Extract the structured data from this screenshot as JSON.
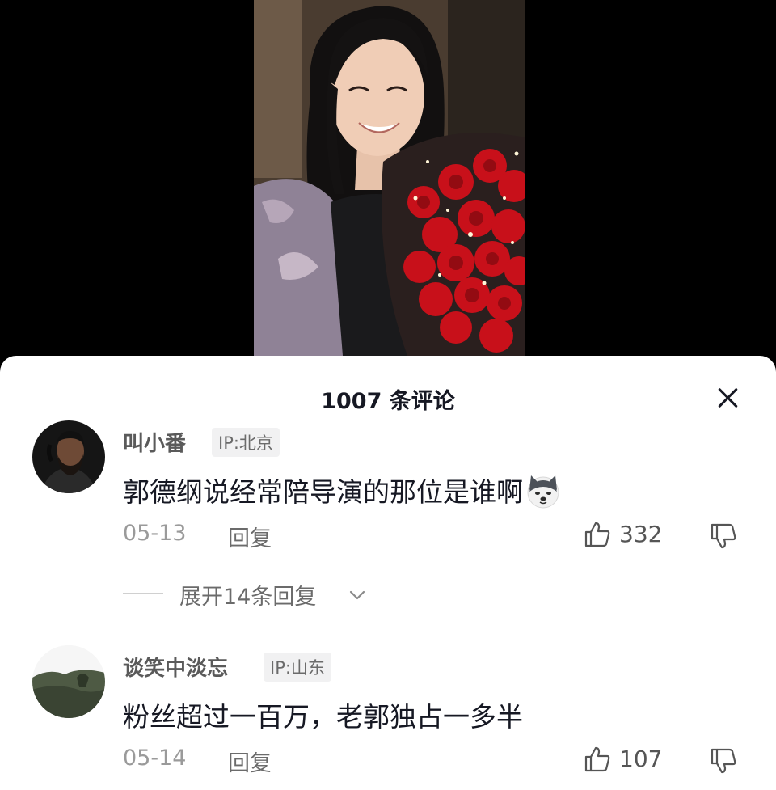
{
  "sheet": {
    "title": "1007 条评论",
    "close_icon": "close-icon"
  },
  "comments": [
    {
      "username": "叫小番",
      "ip": "IP:北京",
      "text": "郭德纲说经常陪导演的那位是谁啊",
      "emoji": "husky-dog-emoji",
      "date": "05-13",
      "reply": "回复",
      "likes": "332",
      "expand": "展开14条回复"
    },
    {
      "username": "谈笑中淡忘",
      "ip": "IP:山东",
      "text": "粉丝超过一百万，老郭独占一多半",
      "date": "05-14",
      "reply": "回复",
      "likes": "107"
    }
  ],
  "colors": {
    "text_primary": "#161823",
    "text_secondary": "#6b6b6b",
    "rose_red": "#c8101a"
  }
}
